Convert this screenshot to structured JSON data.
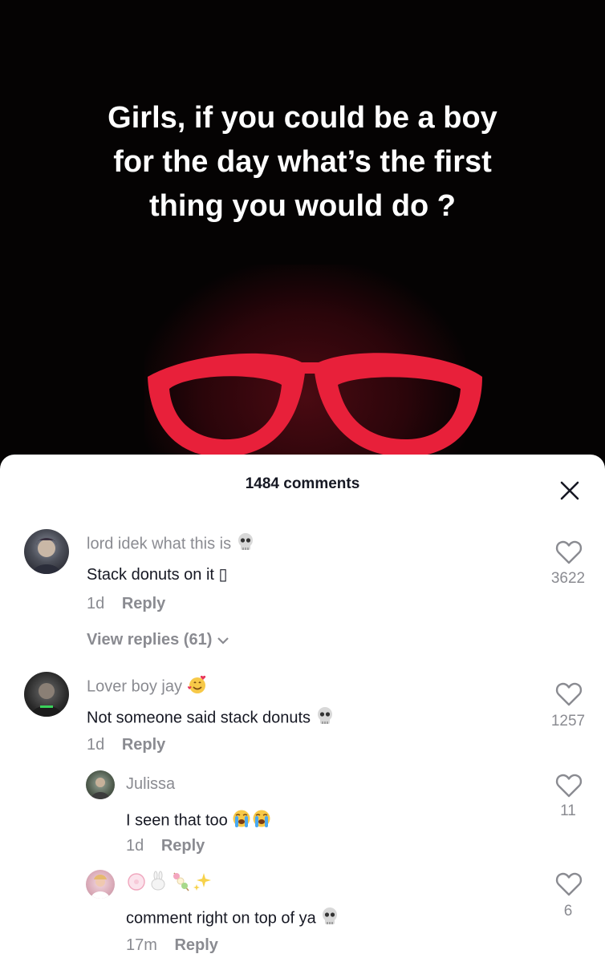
{
  "video": {
    "caption_lines": [
      "Girls, if you could be a boy",
      "for the day what’s the first",
      "thing you would do ?"
    ]
  },
  "comments_sheet": {
    "title": "1484 comments",
    "close_icon": "close-icon"
  },
  "comments": [
    {
      "username": "lord idek what this is",
      "username_emoji": "skull",
      "text": "Stack donuts on it",
      "text_suffix": "▯",
      "time": "1d",
      "reply_label": "Reply",
      "likes": "3622",
      "view_replies": "View replies (61)"
    },
    {
      "username": "Lover boy jay",
      "username_emoji": "smiling-face-with-hearts",
      "text": "Not someone said stack donuts",
      "text_emoji": "skull",
      "time": "1d",
      "reply_label": "Reply",
      "likes": "1257"
    }
  ],
  "replies": [
    {
      "username": "Julissa",
      "text": "I seen that too",
      "text_emoji": "loudly-crying-face x2",
      "time": "1d",
      "reply_label": "Reply",
      "likes": "11"
    },
    {
      "username_emoji": "pink flower, bunny, dango, sparkles",
      "text": "comment right on top of ya",
      "text_emoji": "skull",
      "time": "17m",
      "reply_label": "Reply",
      "likes": "6"
    }
  ],
  "colors": {
    "text_primary": "#161823",
    "text_secondary": "#8a8b91",
    "glasses_red": "#e8203a"
  }
}
